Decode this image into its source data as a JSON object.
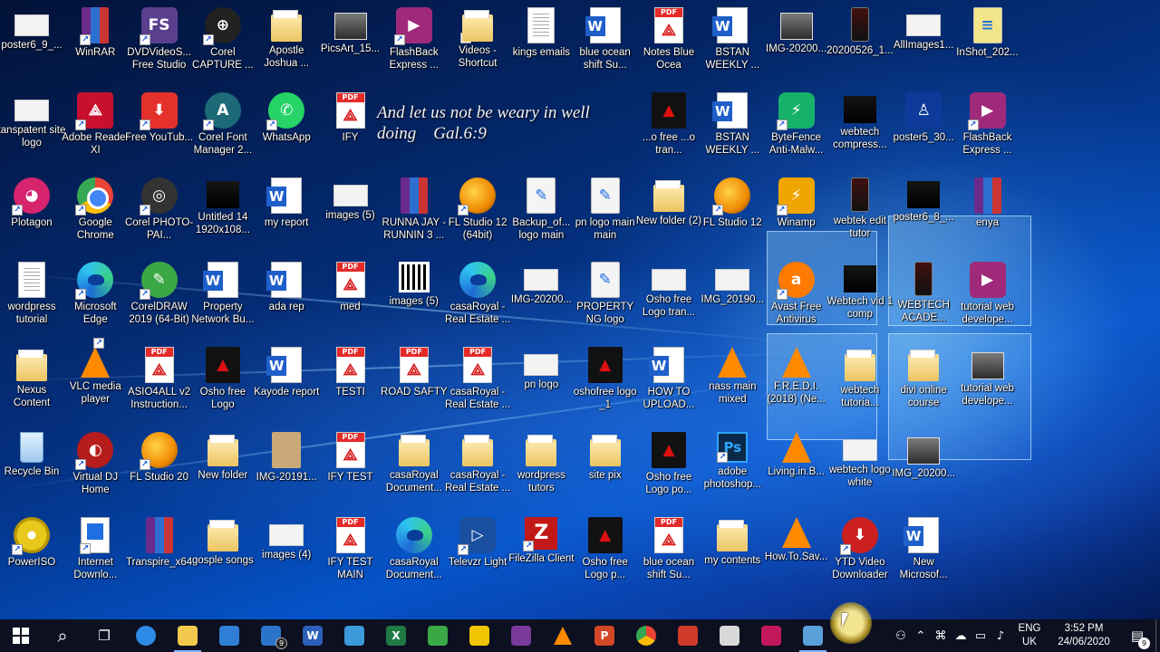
{
  "desktop": {
    "verse": {
      "line1": "And let us not be weary in well",
      "line2": "doing    Gal.6:9"
    },
    "icons": [
      {
        "label": "poster6_9_...",
        "icon": "image-icon",
        "kind": "logo",
        "shortcut": false
      },
      {
        "label": "WinRAR",
        "icon": "winrar-icon",
        "kind": "rar",
        "shortcut": true
      },
      {
        "label": "DVDVideoS... Free Studio",
        "icon": "dvdvideosoft-icon",
        "kind": "fs",
        "shortcut": true
      },
      {
        "label": "Corel CAPTURE ...",
        "icon": "corel-capture-icon",
        "kind": "capture",
        "shortcut": true
      },
      {
        "label": "Apostle Joshua ...",
        "icon": "folder-icon",
        "kind": "folder",
        "shortcut": false
      },
      {
        "label": "PicsArt_15...",
        "icon": "image-icon",
        "kind": "img",
        "shortcut": false
      },
      {
        "label": "FlashBack Express ...",
        "icon": "flashback-icon",
        "kind": "flashback",
        "shortcut": true
      },
      {
        "label": "Videos - Shortcut",
        "icon": "folder-icon",
        "kind": "folder",
        "shortcut": true
      },
      {
        "label": "kings emails",
        "icon": "text-file-icon",
        "kind": "txt",
        "shortcut": false
      },
      {
        "label": "blue ocean shift Su...",
        "icon": "word-doc-icon",
        "kind": "word",
        "shortcut": false
      },
      {
        "label": "Notes Blue Ocea",
        "icon": "pdf-icon",
        "kind": "pdf",
        "shortcut": false
      },
      {
        "label": "BSTAN WEEKLY ...",
        "icon": "word-doc-icon",
        "kind": "word",
        "shortcut": false
      },
      {
        "label": "IMG-20200...",
        "icon": "image-icon",
        "kind": "img",
        "shortcut": false
      },
      {
        "label": "20200526_1...",
        "icon": "phone-image-icon",
        "kind": "phone",
        "shortcut": false
      },
      {
        "label": "AllImages1...",
        "icon": "image-icon",
        "kind": "logo",
        "shortcut": false
      },
      {
        "label": "InShot_202...",
        "icon": "image-icon",
        "kind": "yellowimg",
        "shortcut": false
      },
      {
        "label": "tanspatent site logo",
        "icon": "image-icon",
        "kind": "logo",
        "shortcut": false
      },
      {
        "label": "Adobe Reader XI",
        "icon": "adobe-reader-icon",
        "kind": "adobe",
        "shortcut": true
      },
      {
        "label": "Free YouTub...",
        "icon": "youtube-downloader-icon",
        "kind": "ytdl",
        "shortcut": true
      },
      {
        "label": "Corel Font Manager 2...",
        "icon": "corel-font-icon",
        "kind": "fontmgr",
        "shortcut": true
      },
      {
        "label": "WhatsApp",
        "icon": "whatsapp-icon",
        "kind": "whatsapp",
        "shortcut": true
      },
      {
        "label": "IFY",
        "icon": "pdf-icon",
        "kind": "pdf",
        "shortcut": false
      },
      {
        "label": "...o free ...o tran...",
        "icon": "image-icon",
        "kind": "redlogo",
        "shortcut": false
      },
      {
        "label": "BSTAN WEEKLY ...",
        "icon": "word-doc-icon",
        "kind": "word",
        "shortcut": false
      },
      {
        "label": "ByteFence Anti-Malw...",
        "icon": "bytefence-icon",
        "kind": "bytefence",
        "shortcut": true
      },
      {
        "label": "webtech compress...",
        "icon": "video-icon",
        "kind": "dark",
        "shortcut": false
      },
      {
        "label": "poster5_30...",
        "icon": "image-icon",
        "kind": "bluefig",
        "shortcut": false
      },
      {
        "label": "FlashBack Express ...",
        "icon": "flashback-icon",
        "kind": "flashback",
        "shortcut": true
      },
      {
        "label": "Plotagon",
        "icon": "plotagon-icon",
        "kind": "plotagon",
        "shortcut": true
      },
      {
        "label": "Google Chrome",
        "icon": "chrome-icon",
        "kind": "chrome",
        "shortcut": true
      },
      {
        "label": "Corel PHOTO-PAI...",
        "icon": "corel-photopaint-icon",
        "kind": "photopaint",
        "shortcut": true
      },
      {
        "label": "Untitled 14 1920x108...",
        "icon": "image-icon",
        "kind": "dark",
        "shortcut": false
      },
      {
        "label": "my report",
        "icon": "word-doc-icon",
        "kind": "word",
        "shortcut": false
      },
      {
        "label": "images (5)",
        "icon": "image-icon",
        "kind": "logo",
        "shortcut": false
      },
      {
        "label": "RUNNA JAY - RUNNIN 3 ...",
        "icon": "winrar-icon",
        "kind": "rar",
        "shortcut": false
      },
      {
        "label": "FL Studio 12 (64bit)",
        "icon": "fl-studio-icon",
        "kind": "fl",
        "shortcut": true
      },
      {
        "label": "Backup_of... logo main",
        "icon": "corel-file-icon",
        "kind": "corelfile",
        "shortcut": false
      },
      {
        "label": "pn logo main main",
        "icon": "corel-file-icon",
        "kind": "corelfile",
        "shortcut": false
      },
      {
        "label": "New folder (2)",
        "icon": "folder-icon",
        "kind": "folder",
        "shortcut": false
      },
      {
        "label": "FL Studio 12",
        "icon": "fl-studio-icon",
        "kind": "fl",
        "shortcut": true
      },
      {
        "label": "Winamp",
        "icon": "winamp-icon",
        "kind": "winamp",
        "shortcut": true
      },
      {
        "label": "webtek edit tutor",
        "icon": "phone-image-icon",
        "kind": "phone",
        "shortcut": false
      },
      {
        "label": "poster6_8_...",
        "icon": "image-icon",
        "kind": "dark",
        "shortcut": false
      },
      {
        "label": "enya",
        "icon": "winrar-icon",
        "kind": "rar",
        "shortcut": false
      },
      {
        "label": "wordpress tutorial",
        "icon": "text-file-icon",
        "kind": "txt",
        "shortcut": false
      },
      {
        "label": "Microsoft Edge",
        "icon": "edge-icon",
        "kind": "edge",
        "shortcut": true
      },
      {
        "label": "CorelDRAW 2019 (64-Bit)",
        "icon": "coreldraw-icon",
        "kind": "coreldraw",
        "shortcut": true
      },
      {
        "label": "Property Network Bu...",
        "icon": "word-doc-icon",
        "kind": "word",
        "shortcut": false
      },
      {
        "label": "ada rep",
        "icon": "word-doc-icon",
        "kind": "word",
        "shortcut": false
      },
      {
        "label": "med",
        "icon": "pdf-icon",
        "kind": "pdf",
        "shortcut": false
      },
      {
        "label": "images (5)",
        "icon": "qr-image-icon",
        "kind": "qr",
        "shortcut": false
      },
      {
        "label": "casaRoyal - Real Estate ...",
        "icon": "edge-icon",
        "kind": "edge",
        "shortcut": false
      },
      {
        "label": "IMG-20200...",
        "icon": "image-icon",
        "kind": "logo",
        "shortcut": false
      },
      {
        "label": "PROPERTY NG logo",
        "icon": "corel-file-icon",
        "kind": "corelfile",
        "shortcut": false
      },
      {
        "label": "Osho free Logo tran...",
        "icon": "image-icon",
        "kind": "logo",
        "shortcut": false
      },
      {
        "label": "IMG_20190...",
        "icon": "image-icon",
        "kind": "logo",
        "shortcut": false
      },
      {
        "label": "Avast Free Antivirus",
        "icon": "avast-icon",
        "kind": "avast",
        "shortcut": true
      },
      {
        "label": "Webtech vid 1 comp",
        "icon": "video-icon",
        "kind": "dark",
        "shortcut": false
      },
      {
        "label": "WEBTECH ACADE...",
        "icon": "phone-image-icon",
        "kind": "phone",
        "shortcut": false
      },
      {
        "label": "tutorial web develope...",
        "icon": "flashback-icon",
        "kind": "flashback",
        "shortcut": false
      },
      {
        "label": "Nexus Content",
        "icon": "folder-icon",
        "kind": "folder",
        "shortcut": false
      },
      {
        "label": "VLC media player",
        "icon": "vlc-icon",
        "kind": "vlc",
        "shortcut": true
      },
      {
        "label": "ASIO4ALL v2 Instruction...",
        "icon": "pdf-icon",
        "kind": "pdf",
        "shortcut": false
      },
      {
        "label": "Osho free Logo",
        "icon": "image-icon",
        "kind": "redlogo",
        "shortcut": false
      },
      {
        "label": "Kayode report",
        "icon": "word-doc-icon",
        "kind": "word",
        "shortcut": false
      },
      {
        "label": "TESTI",
        "icon": "pdf-icon",
        "kind": "pdf",
        "shortcut": false
      },
      {
        "label": "ROAD SAFTY",
        "icon": "pdf-icon",
        "kind": "pdf",
        "shortcut": false
      },
      {
        "label": "casaRoyal - Real Estate ...",
        "icon": "pdf-icon",
        "kind": "pdf",
        "shortcut": false
      },
      {
        "label": "pn logo",
        "icon": "image-icon",
        "kind": "logo",
        "shortcut": false
      },
      {
        "label": "oshofree logo _1",
        "icon": "image-icon",
        "kind": "redlogo",
        "shortcut": false
      },
      {
        "label": "HOW TO UPLOAD...",
        "icon": "word-doc-icon",
        "kind": "word",
        "shortcut": false
      },
      {
        "label": "nass main mixed",
        "icon": "vlc-icon",
        "kind": "vlc",
        "shortcut": false
      },
      {
        "label": "F.R.E.D.I. (2018) (Ne...",
        "icon": "vlc-icon",
        "kind": "vlc",
        "shortcut": false
      },
      {
        "label": "webtech tutoria...",
        "icon": "folder-icon",
        "kind": "folder",
        "shortcut": false
      },
      {
        "label": "divi online course",
        "icon": "folder-icon",
        "kind": "folder",
        "shortcut": false
      },
      {
        "label": "tutorial web develope...",
        "icon": "video-icon",
        "kind": "img",
        "shortcut": false
      },
      {
        "label": "Recycle Bin",
        "icon": "recycle-bin-icon",
        "kind": "bin",
        "shortcut": false
      },
      {
        "label": "Virtual DJ Home",
        "icon": "virtual-dj-icon",
        "kind": "vdj",
        "shortcut": true
      },
      {
        "label": "FL Studio 20",
        "icon": "fl-studio-icon",
        "kind": "fl",
        "shortcut": true
      },
      {
        "label": "New folder",
        "icon": "folder-icon",
        "kind": "folder",
        "shortcut": false
      },
      {
        "label": "IMG-20191...",
        "icon": "image-icon",
        "kind": "beige",
        "shortcut": false
      },
      {
        "label": "IFY TEST",
        "icon": "pdf-icon",
        "kind": "pdf",
        "shortcut": false
      },
      {
        "label": "casaRoyal Document...",
        "icon": "folder-icon",
        "kind": "folder",
        "shortcut": false
      },
      {
        "label": "casaRoyal - Real Estate ...",
        "icon": "folder-icon",
        "kind": "folder",
        "shortcut": false
      },
      {
        "label": "wordpress tutors",
        "icon": "folder-icon",
        "kind": "folder",
        "shortcut": false
      },
      {
        "label": "site pix",
        "icon": "folder-icon",
        "kind": "folder",
        "shortcut": false
      },
      {
        "label": "Osho free Logo po...",
        "icon": "image-icon",
        "kind": "redlogo",
        "shortcut": false
      },
      {
        "label": "adobe photoshop...",
        "icon": "photoshop-icon",
        "kind": "ps",
        "shortcut": true
      },
      {
        "label": "Living.in.B...",
        "icon": "vlc-icon",
        "kind": "vlc",
        "shortcut": false
      },
      {
        "label": "webtech logo white",
        "icon": "image-icon",
        "kind": "logo",
        "shortcut": false
      },
      {
        "label": "IMG_20200...",
        "icon": "image-icon",
        "kind": "img",
        "shortcut": false
      },
      {
        "label": "PowerISO",
        "icon": "poweriso-icon",
        "kind": "cd",
        "shortcut": true
      },
      {
        "label": "Internet Downlo...",
        "icon": "internet-download-manager-icon",
        "kind": "ie",
        "shortcut": true
      },
      {
        "label": "Transpire_x64",
        "icon": "winrar-icon",
        "kind": "rar",
        "shortcut": false
      },
      {
        "label": "gosple songs",
        "icon": "folder-icon",
        "kind": "folder",
        "shortcut": false
      },
      {
        "label": "images (4)",
        "icon": "image-icon",
        "kind": "logo",
        "shortcut": false
      },
      {
        "label": "IFY TEST MAIN",
        "icon": "pdf-icon",
        "kind": "pdf",
        "shortcut": false
      },
      {
        "label": "casaRoyal Document...",
        "icon": "edge-icon",
        "kind": "edge",
        "shortcut": false
      },
      {
        "label": "Televzr Light",
        "icon": "televzr-icon",
        "kind": "televzr",
        "shortcut": true
      },
      {
        "label": "FileZilla Client",
        "icon": "filezilla-icon",
        "kind": "fz",
        "shortcut": true
      },
      {
        "label": "Osho free Logo p...",
        "icon": "image-icon",
        "kind": "redlogo",
        "shortcut": false
      },
      {
        "label": "blue ocean shift Su...",
        "icon": "pdf-icon",
        "kind": "pdf",
        "shortcut": false
      },
      {
        "label": "my contents",
        "icon": "folder-icon",
        "kind": "folder",
        "shortcut": false
      },
      {
        "label": "How.To.Sav...",
        "icon": "vlc-icon",
        "kind": "vlc",
        "shortcut": false
      },
      {
        "label": "YTD Video Downloader",
        "icon": "ytd-downloader-icon",
        "kind": "ytd",
        "shortcut": true
      },
      {
        "label": "New Microsof...",
        "icon": "word-doc-icon",
        "kind": "word",
        "shortcut": false
      }
    ]
  },
  "taskbar": {
    "apps": [
      {
        "name": "start-button",
        "icon": "windows-icon"
      },
      {
        "name": "search-button",
        "icon": "search-icon"
      },
      {
        "name": "task-view-button",
        "icon": "task-view-icon"
      },
      {
        "name": "taskbar-edge",
        "icon": "edge-icon",
        "color": "#2d8ae6"
      },
      {
        "name": "taskbar-file-explorer",
        "icon": "folder-icon",
        "color": "#f2c94c",
        "active": true
      },
      {
        "name": "taskbar-store",
        "icon": "store-icon",
        "color": "#2f7fd6"
      },
      {
        "name": "taskbar-mail",
        "icon": "mail-icon",
        "color": "#2a74c9",
        "badge": "9"
      },
      {
        "name": "taskbar-word",
        "icon": "word-icon",
        "color": "#2b5fb8",
        "letter": "W"
      },
      {
        "name": "taskbar-app",
        "icon": "app-icon",
        "color": "#3b9ad9"
      },
      {
        "name": "taskbar-excel",
        "icon": "excel-icon",
        "color": "#1f7a44",
        "letter": "X"
      },
      {
        "name": "taskbar-coreldraw",
        "icon": "coreldraw-icon",
        "color": "#3aa845"
      },
      {
        "name": "taskbar-corel-capture",
        "icon": "capture-icon",
        "color": "#f0c400"
      },
      {
        "name": "taskbar-winrar",
        "icon": "winrar-icon",
        "color": "#7a3a9a"
      },
      {
        "name": "taskbar-vlc",
        "icon": "vlc-icon",
        "color": "#ff8a00"
      },
      {
        "name": "taskbar-powerpoint",
        "icon": "powerpoint-icon",
        "color": "#d24726",
        "letter": "P"
      },
      {
        "name": "taskbar-chrome",
        "icon": "chrome-icon",
        "color": "#e8453c"
      },
      {
        "name": "taskbar-photopaint",
        "icon": "photopaint-icon",
        "color": "#d03a2a"
      },
      {
        "name": "taskbar-flashback",
        "icon": "flashback-icon",
        "color": "#d8d8d8"
      },
      {
        "name": "taskbar-plotagon",
        "icon": "plotagon-icon",
        "color": "#c2185b"
      },
      {
        "name": "taskbar-notepad",
        "icon": "notepad-icon",
        "color": "#5aa0d8",
        "active": true
      }
    ],
    "tray": {
      "lang_line1": "ENG",
      "lang_line2": "UK",
      "time": "3:52 PM",
      "date": "24/06/2020",
      "notification_count": "9"
    }
  },
  "colors": {
    "taskbar": "#0d1020",
    "label_text": "#ffffff",
    "accent": "#7fb4ff"
  }
}
